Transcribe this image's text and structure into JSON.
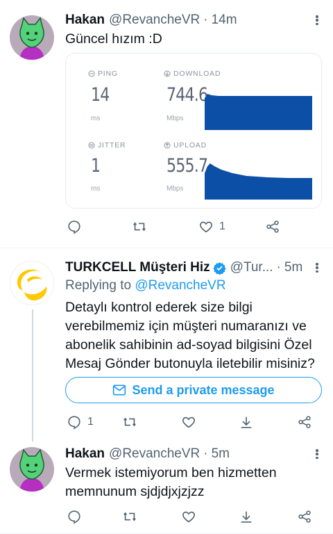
{
  "tweet1": {
    "name": "Hakan",
    "handle": "@RevancheVR",
    "sep": "·",
    "time": "14m",
    "text": "Güncel hızım :D",
    "like_count": "1",
    "speedtest": {
      "ping_label": "PING",
      "ping_value": "14",
      "ping_unit": "ms",
      "download_label": "DOWNLOAD",
      "download_value": "744.6",
      "download_unit": "Mbps",
      "jitter_label": "JITTER",
      "jitter_value": "1",
      "jitter_unit": "ms",
      "upload_label": "UPLOAD",
      "upload_value": "555.7",
      "upload_unit": "Mbps",
      "graph_color": "#0b4fa6"
    }
  },
  "tweet2": {
    "name": "TURKCELL Müşteri Hiz",
    "handle": "@Tur...",
    "sep": "·",
    "time": "5m",
    "reply_prefix": "Replying to",
    "reply_handle": "@RevancheVR",
    "text": "Detaylı kontrol ederek size bilgi verebilmemiz için müşteri numaranızı ve abonelik sahibinin ad-soyad bilgisini Özel Mesaj Gönder butonuyla iletebilir misiniz?",
    "dm_button": "Send a private message",
    "reply_count": "1"
  },
  "tweet3": {
    "name": "Hakan",
    "handle": "@RevancheVR",
    "sep": "·",
    "time": "5m",
    "text": "Vermek istemiyorum ben hizmetten memnunum sjdjdjxjzjzz"
  },
  "colors": {
    "accent": "#1d9bf0",
    "verified": "#1d9bf0",
    "turkcell_yellow": "#ffc900",
    "avatar_bg": "#b3a7b6",
    "avatar_green": "#5bd37a"
  }
}
